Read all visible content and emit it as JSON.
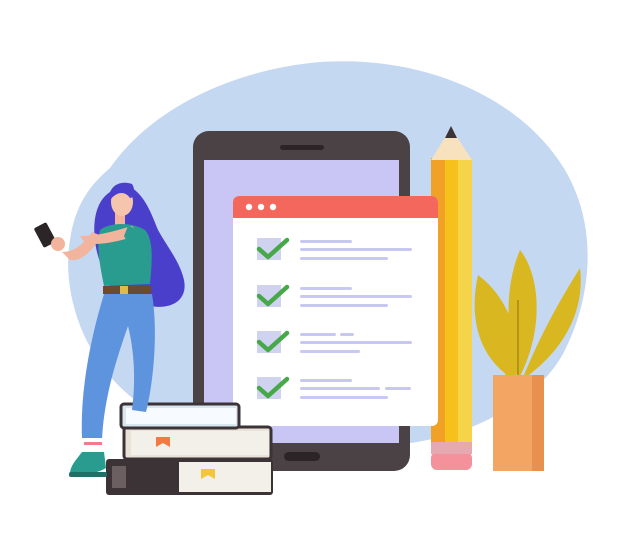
{
  "illustration": {
    "subject": "checklist",
    "elements": [
      "background-blob",
      "smartphone",
      "checklist-window",
      "pencil",
      "potted-plant",
      "stacked-books",
      "woman-with-phone"
    ],
    "checklist": {
      "items_checked": [
        true,
        true,
        true,
        true
      ],
      "window_dots": 3
    }
  },
  "colors": {
    "blob": "#c5d8f2",
    "phone_body": "#4a4244",
    "phone_screen": "#c9c5f5",
    "window_header": "#f4675c",
    "window_body": "#ffffff",
    "checkbox": "#cfd3f0",
    "checkmark": "#47a84a",
    "text_line": "#c7c9f3",
    "pencil_yellow": "#f7c11c",
    "pencil_orange": "#f0a126",
    "pencil_eraser": "#f4919b",
    "plant_leaf": "#d9b721",
    "plant_pot": "#f3a663",
    "hair": "#4a3fcb",
    "shirt": "#2a9c8f",
    "jeans": "#5d94dd",
    "book_dark": "#3b3335",
    "book_page": "#f3efe9",
    "bookmark_orange": "#f27a41",
    "bookmark_yellow": "#f2c53a"
  }
}
